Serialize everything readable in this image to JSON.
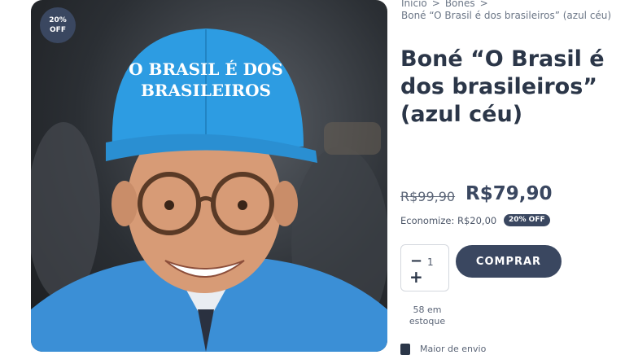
{
  "product": {
    "badge": {
      "percent": "20%",
      "label": "OFF"
    },
    "hat_text": [
      "O BRASIL É DOS",
      "BRASILEIROS"
    ],
    "title": "Boné “O Brasil é dos brasileiros” (azul céu)",
    "price_old": "R$99,90",
    "price_new": "R$79,90",
    "savings": "Economize: R$20,00",
    "savings_badge": "20% OFF"
  },
  "breadcrumb": {
    "items": [
      "Início",
      "Bonés"
    ],
    "separator": ">",
    "current": "Boné “O Brasil é dos brasileiros” (azul céu)"
  },
  "purchase": {
    "quantity": "1",
    "minus": "−",
    "plus": "+",
    "buy_label": "COMPRAR",
    "stock": "58 em estoque",
    "more_label": "Maior de envio"
  },
  "colors": {
    "accent": "#3a4760",
    "cap_blue": "#2d9ce2",
    "jacket_blue": "#3b8fd6"
  }
}
